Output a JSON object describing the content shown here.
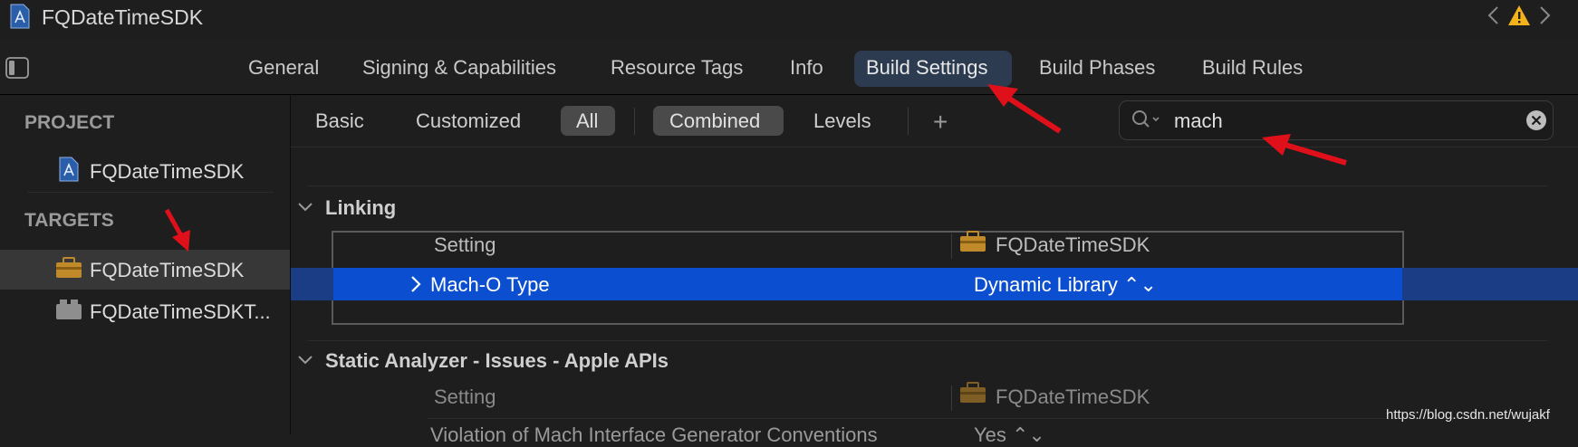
{
  "window": {
    "title": "FQDateTimeSDK"
  },
  "tabs": [
    {
      "label": "General"
    },
    {
      "label": "Signing & Capabilities"
    },
    {
      "label": "Resource Tags"
    },
    {
      "label": "Info"
    },
    {
      "label": "Build Settings",
      "active": true
    },
    {
      "label": "Build Phases"
    },
    {
      "label": "Build Rules"
    }
  ],
  "sidebar": {
    "project_header": "PROJECT",
    "project_item": "FQDateTimeSDK",
    "targets_header": "TARGETS",
    "targets": [
      {
        "label": "FQDateTimeSDK",
        "selected": true
      },
      {
        "label": "FQDateTimeSDKT..."
      }
    ]
  },
  "filters": {
    "basic": "Basic",
    "customized": "Customized",
    "all": "All",
    "combined": "Combined",
    "levels": "Levels",
    "add": "+"
  },
  "search": {
    "value": "mach"
  },
  "sections": [
    {
      "title": "Linking",
      "col_setting": "Setting",
      "col_target": "FQDateTimeSDK",
      "rows": [
        {
          "name": "Mach-O Type",
          "value": "Dynamic Library ⌃⌄"
        }
      ]
    },
    {
      "title": "Static Analyzer - Issues - Apple APIs",
      "col_setting": "Setting",
      "col_target": "FQDateTimeSDK",
      "rows": [
        {
          "name": "Violation of Mach Interface Generator Conventions",
          "value": "Yes ⌃⌄"
        }
      ]
    }
  ],
  "watermark": "https://blog.csdn.net/wujakf",
  "colors": {
    "selection": "#0b4fd0",
    "annotation_arrow": "#e0101a",
    "warning": "#f2b21b"
  }
}
